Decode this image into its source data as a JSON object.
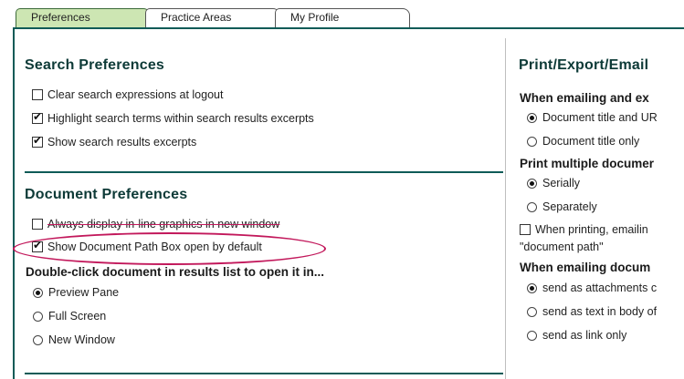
{
  "tabs": [
    {
      "label": "Preferences",
      "active": true
    },
    {
      "label": "Practice Areas",
      "active": false
    },
    {
      "label": "My Profile",
      "active": false
    }
  ],
  "search_prefs": {
    "title": "Search Preferences",
    "options": [
      {
        "label": "Clear search expressions at logout",
        "checked": false
      },
      {
        "label": "Highlight search terms within search results excerpts",
        "checked": true
      },
      {
        "label": "Show search results excerpts",
        "checked": true
      }
    ]
  },
  "document_prefs": {
    "title": "Document Preferences",
    "options": [
      {
        "label": "Always display in-line graphics in new window",
        "checked": false
      },
      {
        "label": "Show Document Path Box open by default",
        "checked": true
      }
    ],
    "dblclick_title": "Double-click document in results list to open it in...",
    "dblclick_options": [
      {
        "label": "Preview Pane",
        "selected": true
      },
      {
        "label": "Full Screen",
        "selected": false
      },
      {
        "label": "New Window",
        "selected": false
      }
    ]
  },
  "print_prefs": {
    "title": "Print/Export/Email",
    "emailing_title": "When emailing and ex",
    "emailing_options": [
      {
        "label": "Document title and UR",
        "selected": true
      },
      {
        "label": "Document title only",
        "selected": false
      }
    ],
    "multiple_title": "Print multiple documer",
    "multiple_options": [
      {
        "label": "Serially",
        "selected": true
      },
      {
        "label": "Separately",
        "selected": false
      }
    ],
    "printing_checkbox": {
      "label": "When printing, emailin",
      "checked": false
    },
    "printing_continuation": "\"document path\"",
    "emailing_docs_title": "When emailing docum",
    "emailing_docs_options": [
      {
        "label": "send as attachments c",
        "selected": true
      },
      {
        "label": "send as text in body of",
        "selected": false
      },
      {
        "label": "send as link only",
        "selected": false
      }
    ]
  },
  "colors": {
    "accent": "#0e5b57",
    "active_tab": "#cde6b3",
    "highlight": "#c2185b"
  }
}
